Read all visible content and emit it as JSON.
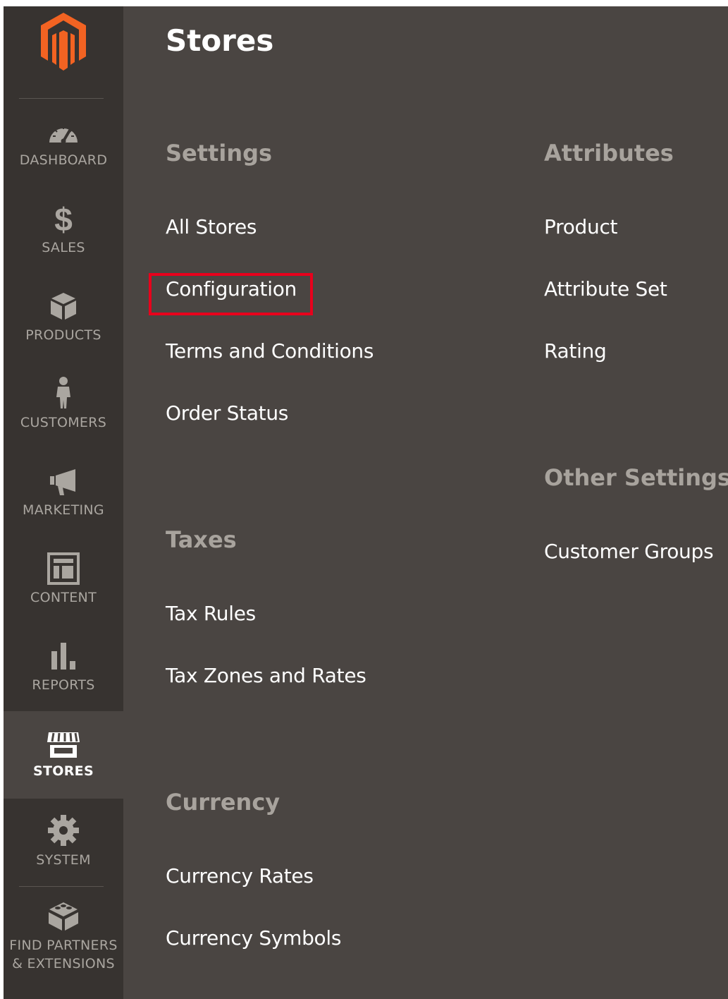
{
  "page": {
    "title": "Stores"
  },
  "colors": {
    "panel_background": "#4a4542",
    "sidebar_background": "#373330",
    "brand_orange": "#f26322",
    "highlight_red": "#e8001c",
    "section_title": "#a8a39d",
    "link_text": "#ffffff"
  },
  "sidebar": {
    "logo_icon": "magento-logo-icon",
    "items": [
      {
        "label": "DASHBOARD",
        "icon": "speedometer-icon",
        "active": false
      },
      {
        "label": "SALES",
        "icon": "dollar-icon",
        "active": false
      },
      {
        "label": "PRODUCTS",
        "icon": "box-icon",
        "active": false
      },
      {
        "label": "CUSTOMERS",
        "icon": "person-icon",
        "active": false
      },
      {
        "label": "MARKETING",
        "icon": "megaphone-icon",
        "active": false
      },
      {
        "label": "CONTENT",
        "icon": "layout-icon",
        "active": false
      },
      {
        "label": "REPORTS",
        "icon": "bar-chart-icon",
        "active": false
      },
      {
        "label": "STORES",
        "icon": "storefront-icon",
        "active": true
      },
      {
        "label": "SYSTEM",
        "icon": "gear-icon",
        "active": false
      },
      {
        "label_line1": "FIND PARTNERS",
        "label_line2": "& EXTENSIONS",
        "icon": "blocks-icon",
        "active": false
      }
    ]
  },
  "sections": {
    "settings": {
      "title": "Settings",
      "items": [
        "All Stores",
        "Configuration",
        "Terms and Conditions",
        "Order Status"
      ],
      "highlighted_item": "Configuration"
    },
    "taxes": {
      "title": "Taxes",
      "items": [
        "Tax Rules",
        "Tax Zones and Rates"
      ]
    },
    "currency": {
      "title": "Currency",
      "items": [
        "Currency Rates",
        "Currency Symbols"
      ]
    },
    "attributes": {
      "title": "Attributes",
      "items": [
        "Product",
        "Attribute Set",
        "Rating"
      ]
    },
    "other_settings": {
      "title": "Other Settings",
      "items": [
        "Customer Groups"
      ]
    }
  }
}
